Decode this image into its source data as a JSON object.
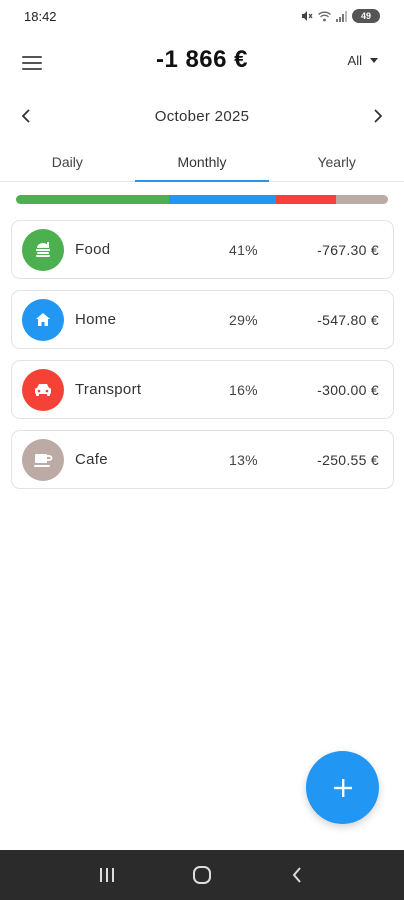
{
  "status_bar": {
    "time": "18:42",
    "battery": "49"
  },
  "header": {
    "total": "-1 866 €",
    "filter_label": "All"
  },
  "month_nav": {
    "label": "October 2025"
  },
  "tabs": [
    {
      "label": "Daily",
      "active": false
    },
    {
      "label": "Monthly",
      "active": true
    },
    {
      "label": "Yearly",
      "active": false
    }
  ],
  "distribution": [
    {
      "category": "Food",
      "fraction": 0.41,
      "color": "#4caf50"
    },
    {
      "category": "Home",
      "fraction": 0.29,
      "color": "#2196f3"
    },
    {
      "category": "Transport",
      "fraction": 0.16,
      "color": "#f44336"
    },
    {
      "category": "Cafe",
      "fraction": 0.14,
      "color": "#bcaaa4"
    }
  ],
  "categories": [
    {
      "name": "Food",
      "percent": "41%",
      "amount": "-767.30 €",
      "color": "#4caf50",
      "icon": "food-icon"
    },
    {
      "name": "Home",
      "percent": "29%",
      "amount": "-547.80 €",
      "color": "#2196f3",
      "icon": "home-icon"
    },
    {
      "name": "Transport",
      "percent": "16%",
      "amount": "-300.00 €",
      "color": "#f44336",
      "icon": "car-icon"
    },
    {
      "name": "Cafe",
      "percent": "13%",
      "amount": "-250.55 €",
      "color": "#bcaaa4",
      "icon": "coffee-icon"
    }
  ],
  "fab": {
    "icon": "plus-icon",
    "color": "#2196f3"
  }
}
